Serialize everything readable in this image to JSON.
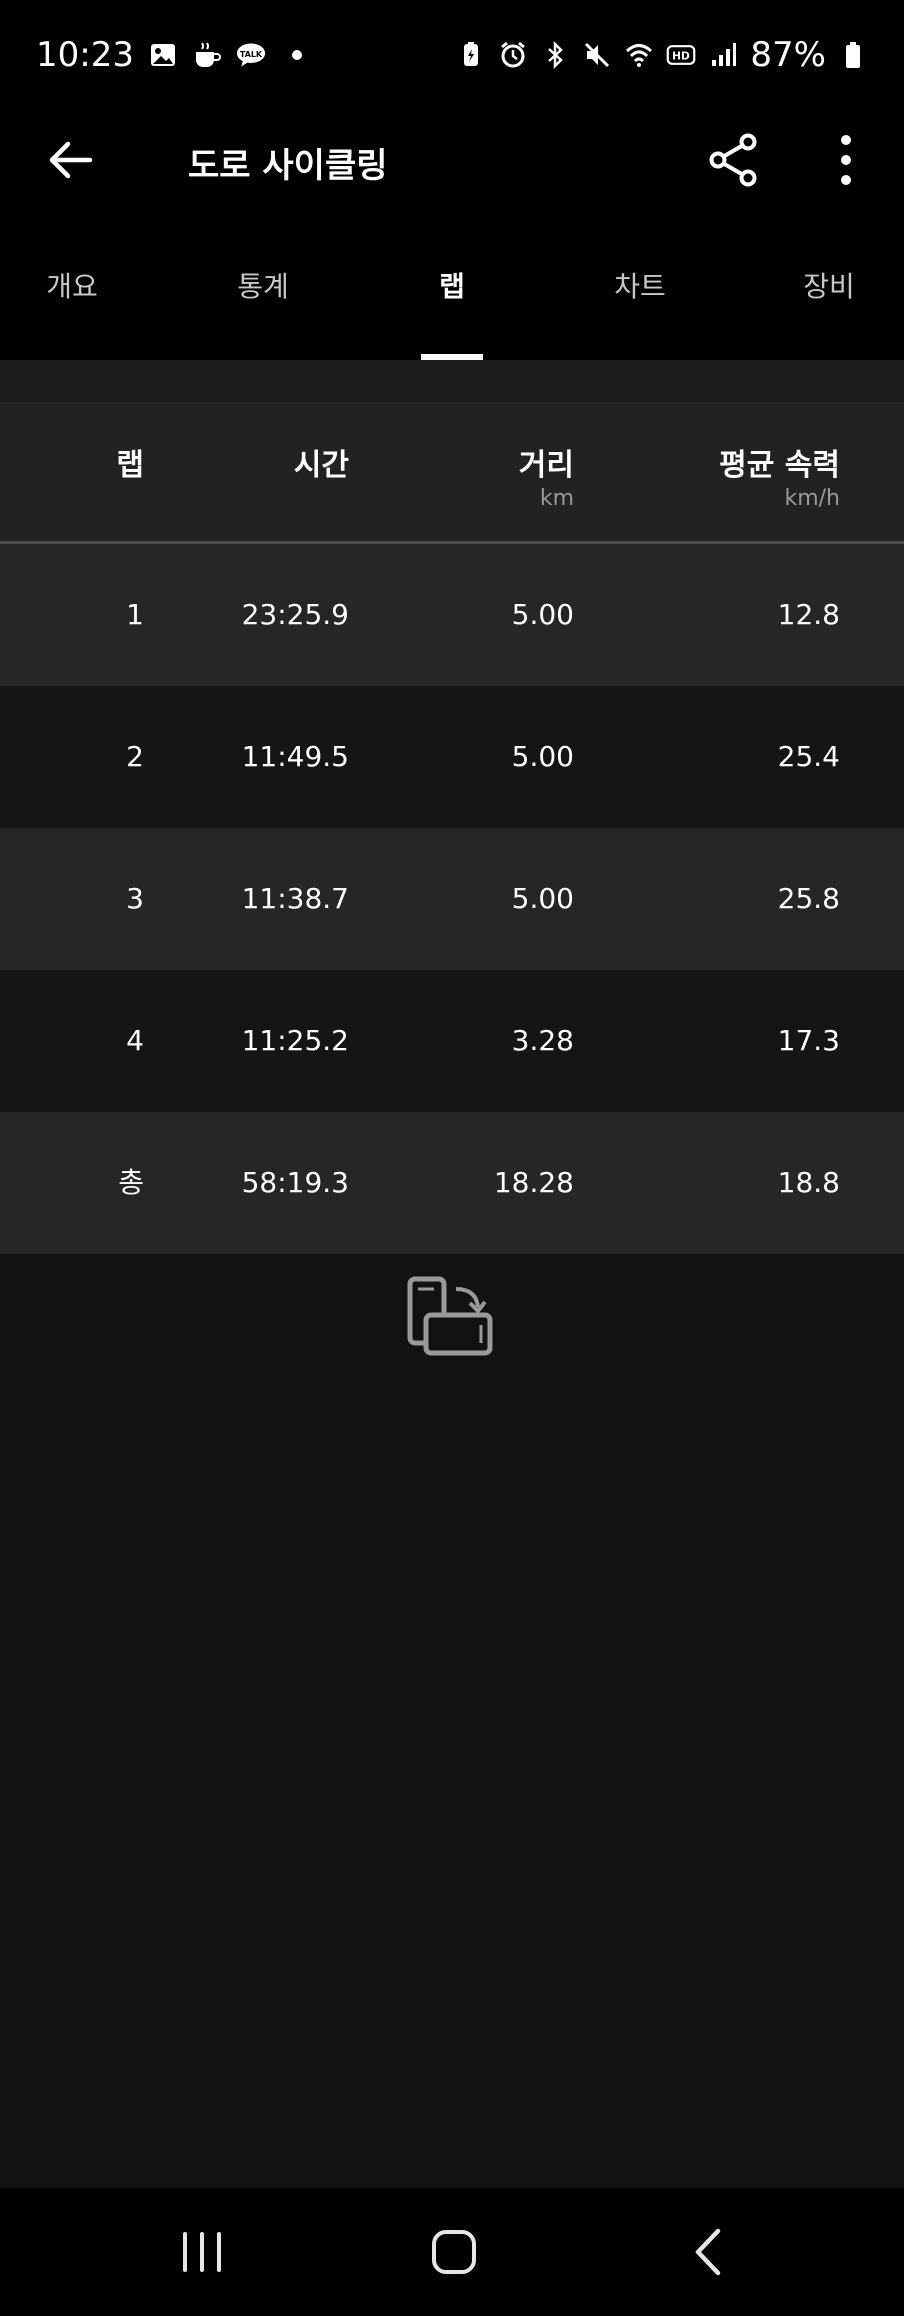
{
  "status_bar": {
    "time": "10:23",
    "battery": "87%",
    "left_icons": [
      "gallery-icon",
      "coffee-icon",
      "talk-icon",
      "dot-icon"
    ],
    "right_icons": [
      "battery-saver-icon",
      "alarm-icon",
      "bluetooth-icon",
      "mute-icon",
      "wifi-icon",
      "hd-icon",
      "signal-icon",
      "battery-icon"
    ]
  },
  "app_bar": {
    "title": "도로 사이클링",
    "back_icon": "arrow-left-icon",
    "share_icon": "share-icon",
    "more_icon": "more-vert-icon"
  },
  "tabs": [
    {
      "label": "개요",
      "active": false
    },
    {
      "label": "통계",
      "active": false
    },
    {
      "label": "랩",
      "active": true
    },
    {
      "label": "차트",
      "active": false
    },
    {
      "label": "장비",
      "active": false
    }
  ],
  "table": {
    "headers": [
      {
        "label": "랩",
        "unit": ""
      },
      {
        "label": "시간",
        "unit": ""
      },
      {
        "label": "거리",
        "unit": "km"
      },
      {
        "label": "평균 속력",
        "unit": "km/h"
      }
    ],
    "rows": [
      [
        "1",
        "23:25.9",
        "5.00",
        "12.8"
      ],
      [
        "2",
        "11:49.5",
        "5.00",
        "25.4"
      ],
      [
        "3",
        "11:38.7",
        "5.00",
        "25.8"
      ],
      [
        "4",
        "11:25.2",
        "3.28",
        "17.3"
      ],
      [
        "총",
        "58:19.3",
        "18.28",
        "18.8"
      ]
    ]
  },
  "rotate_icon": "rotate-screen-icon",
  "nav_bar": {
    "recents_icon": "recents-icon",
    "home_icon": "home-icon",
    "back_icon": "back-chevron-icon"
  }
}
